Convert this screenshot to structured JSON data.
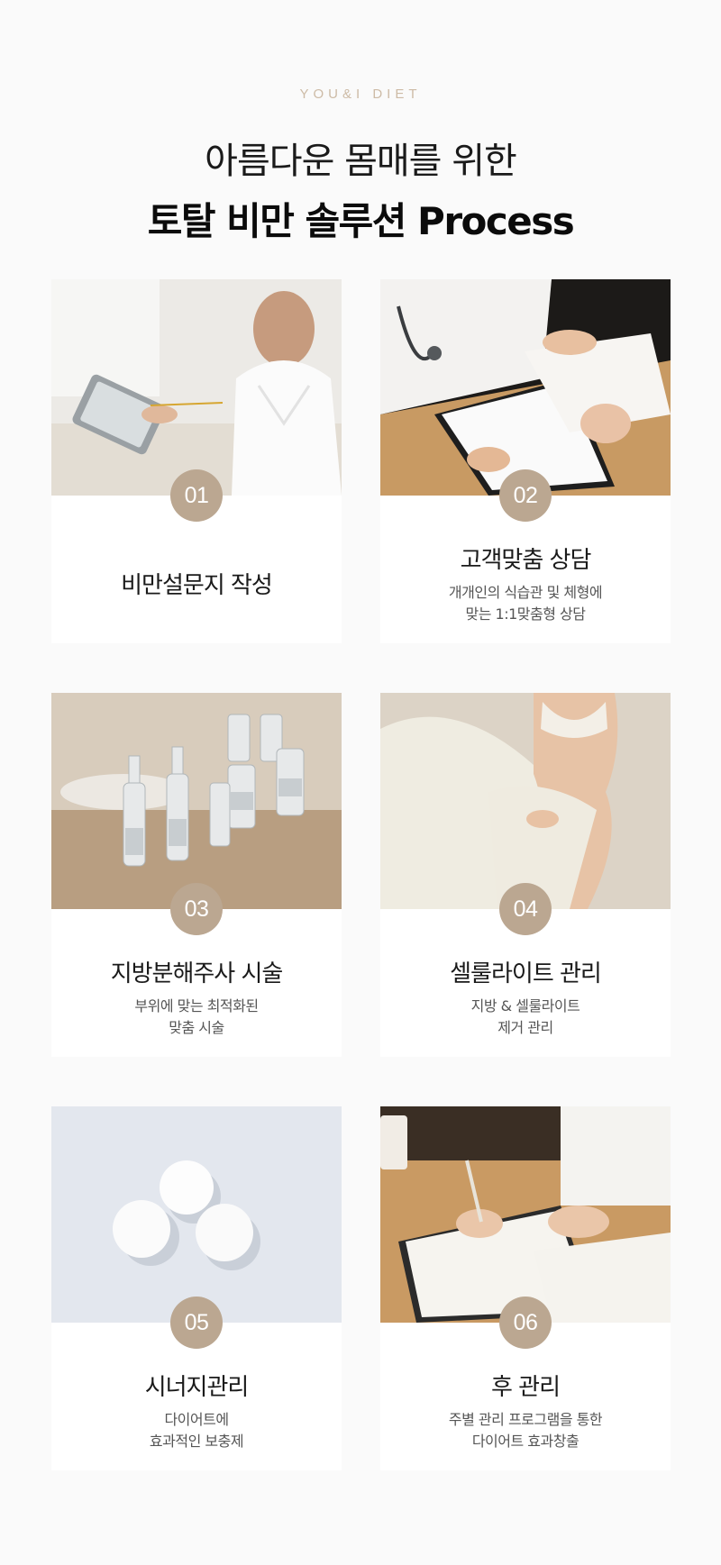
{
  "header": {
    "eyebrow": "YOU&I DIET",
    "title_line1": "아름다운 몸매를 위한",
    "title_line2": "토탈 비만 솔루션 Process"
  },
  "accent_color": "#bba791",
  "steps": [
    {
      "number": "01",
      "title": "비만설문지 작성",
      "desc": [],
      "photo": "woman-with-tablet-photo"
    },
    {
      "number": "02",
      "title": "고객맞춤 상담",
      "desc": [
        "개개인의 식습관 및 체형에",
        "맞는 1:1맞춤형 상담"
      ],
      "photo": "doctor-consultation-photo"
    },
    {
      "number": "03",
      "title": "지방분해주사 시술",
      "desc": [
        "부위에 맞는 최적화된",
        "맞춤 시술"
      ],
      "photo": "ampoules-and-vials-photo"
    },
    {
      "number": "04",
      "title": "셀룰라이트 관리",
      "desc": [
        "지방 & 셀룰라이트",
        "제거 관리"
      ],
      "photo": "slim-body-photo"
    },
    {
      "number": "05",
      "title": "시너지관리",
      "desc": [
        "다이어트에",
        "효과적인 보충제"
      ],
      "photo": "white-pills-photo"
    },
    {
      "number": "06",
      "title": "후 관리",
      "desc": [
        "주별 관리 프로그램을 통한",
        "다이어트 효과창출"
      ],
      "photo": "signing-document-photo"
    }
  ]
}
